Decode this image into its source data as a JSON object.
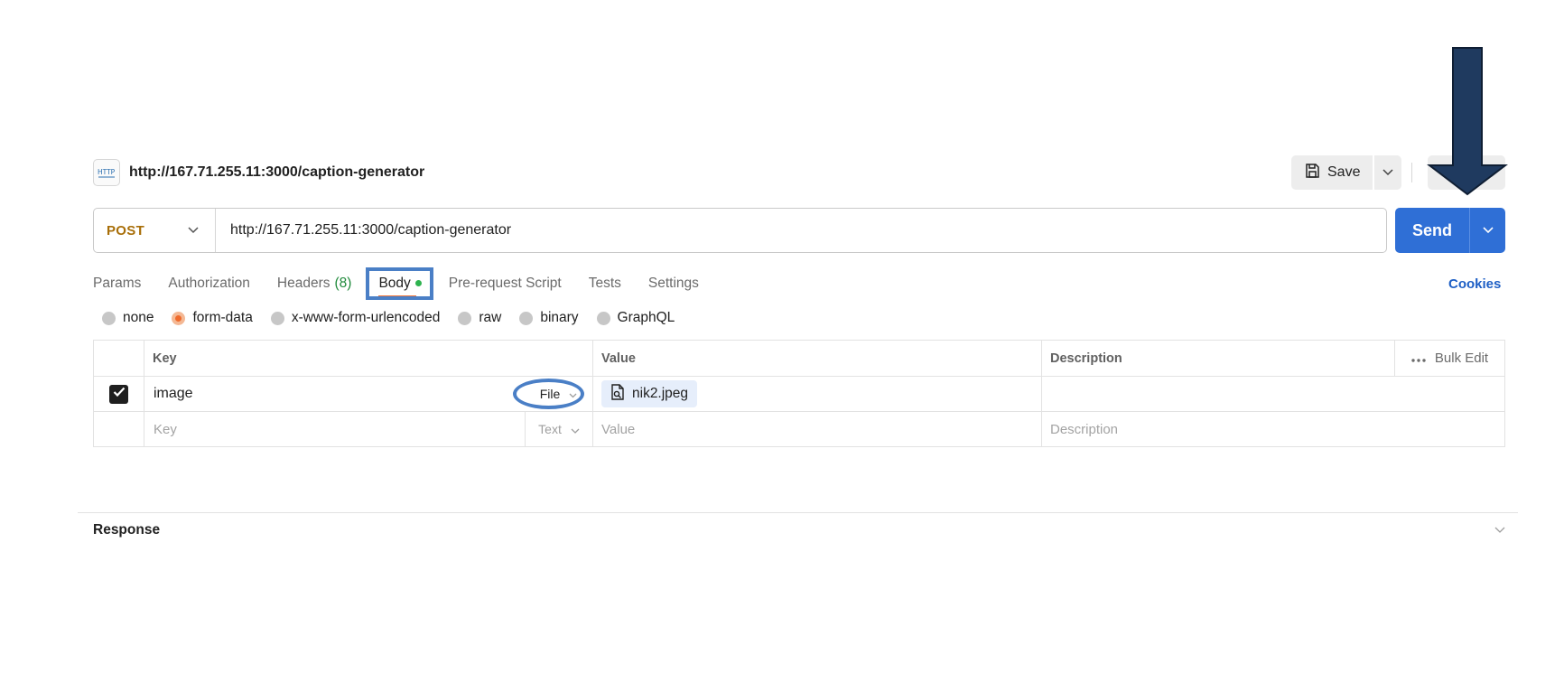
{
  "request": {
    "title": "http://167.71.255.11:3000/caption-generator",
    "icon": "http-icon",
    "method": "POST",
    "url": "http://167.71.255.11:3000/caption-generator"
  },
  "toolbar": {
    "save_label": "Save",
    "send_label": "Send",
    "cookies_label": "Cookies"
  },
  "tabs": [
    {
      "label": "Params"
    },
    {
      "label": "Authorization"
    },
    {
      "label": "Headers",
      "count": "(8)"
    },
    {
      "label": "Body",
      "active": true
    },
    {
      "label": "Pre-request Script"
    },
    {
      "label": "Tests"
    },
    {
      "label": "Settings"
    }
  ],
  "body_types": [
    {
      "label": "none"
    },
    {
      "label": "form-data",
      "selected": true
    },
    {
      "label": "x-www-form-urlencoded"
    },
    {
      "label": "raw"
    },
    {
      "label": "binary"
    },
    {
      "label": "GraphQL"
    }
  ],
  "table": {
    "headers": {
      "key": "Key",
      "value": "Value",
      "description": "Description",
      "bulk_edit": "Bulk Edit"
    },
    "rows": [
      {
        "checked": true,
        "key": "image",
        "type": "File",
        "value": "nik2.jpeg",
        "description": ""
      }
    ],
    "placeholder_row": {
      "key": "Key",
      "type": "Text",
      "value": "Value",
      "description": "Description"
    }
  },
  "response": {
    "label": "Response"
  },
  "colors": {
    "method": "#a86e08",
    "send": "#2f6fd6",
    "cookies": "#1e5fc5",
    "active_tab_underline": "#f0763b",
    "annotation": "#4a7fc6",
    "arrow": "#1f3a5f"
  }
}
